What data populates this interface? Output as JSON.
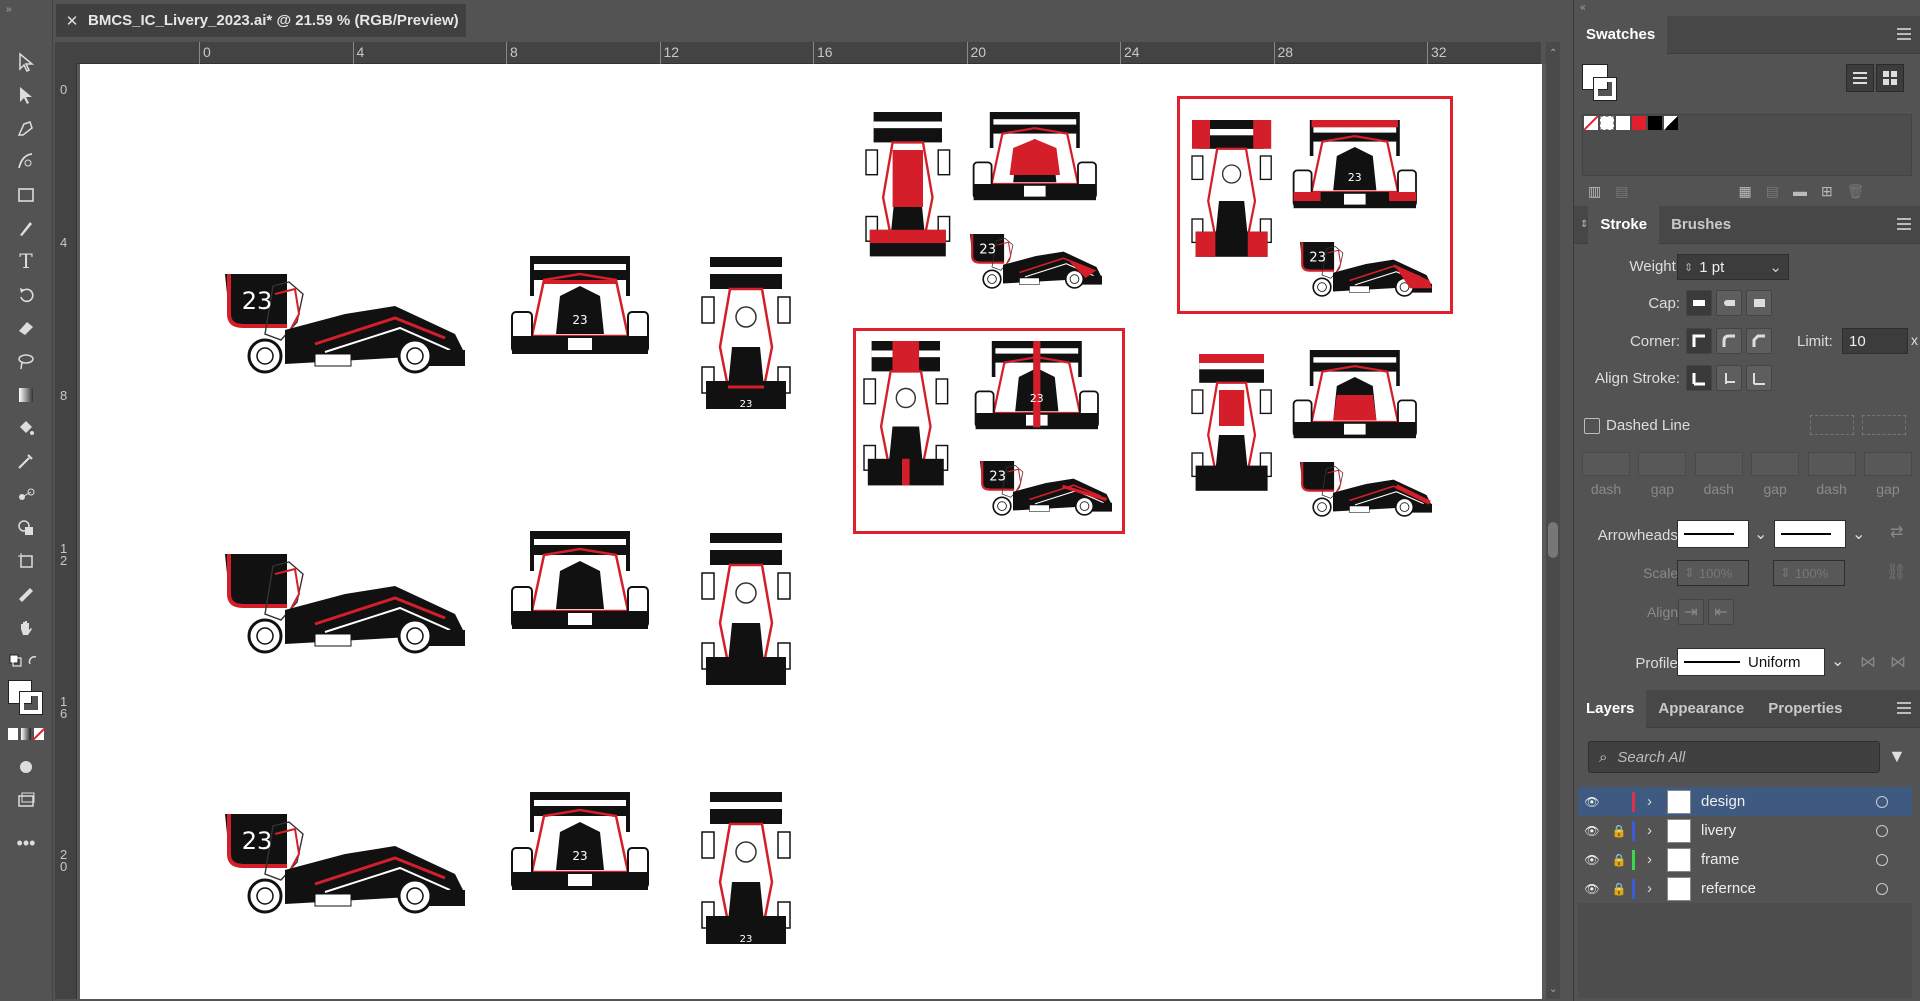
{
  "document": {
    "tab_title": "BMCS_IC_Livery_2023.ai* @ 21.59 % (RGB/Preview)"
  },
  "rulers": {
    "horizontal": [
      "0",
      "4",
      "8",
      "12",
      "16",
      "20",
      "24",
      "28",
      "32"
    ],
    "vertical": [
      "0",
      "4",
      "8",
      "1\n2",
      "1\n6",
      "2\n0"
    ]
  },
  "colors": {
    "accent_red": "#e0202c",
    "livery_red": "#d41f2a",
    "canvas_bg": "#ffffff",
    "panel_bg": "#535353",
    "selection": "#3f5a80"
  },
  "swatches": {
    "title": "Swatches"
  },
  "stroke": {
    "tabs": [
      "Stroke",
      "Brushes"
    ],
    "weight_label": "Weight:",
    "weight_value": "1 pt",
    "cap_label": "Cap:",
    "corner_label": "Corner:",
    "limit_label": "Limit:",
    "limit_value": "10",
    "limit_x": "x",
    "align_label": "Align Stroke:",
    "dashed_label": "Dashed Line",
    "dash_labels": [
      "dash",
      "gap",
      "dash",
      "gap",
      "dash",
      "gap"
    ],
    "arrowheads_label": "Arrowheads:",
    "scale_label": "Scale:",
    "scale_value_1": "100%",
    "scale_value_2": "100%",
    "align2_label": "Align:",
    "profile_label": "Profile:",
    "profile_value": "Uniform"
  },
  "layers_panel": {
    "tabs": [
      "Layers",
      "Appearance",
      "Properties"
    ],
    "search_placeholder": "Search All",
    "layers": [
      {
        "name": "design",
        "color": "#e0304a",
        "locked": false,
        "selected": true
      },
      {
        "name": "livery",
        "color": "#3a5bd9",
        "locked": true,
        "selected": false
      },
      {
        "name": "frame",
        "color": "#3ad94a",
        "locked": true,
        "selected": false
      },
      {
        "name": "refernce",
        "color": "#3a5bd9",
        "locked": true,
        "selected": false
      }
    ]
  },
  "artwork": {
    "car_number": "23"
  }
}
